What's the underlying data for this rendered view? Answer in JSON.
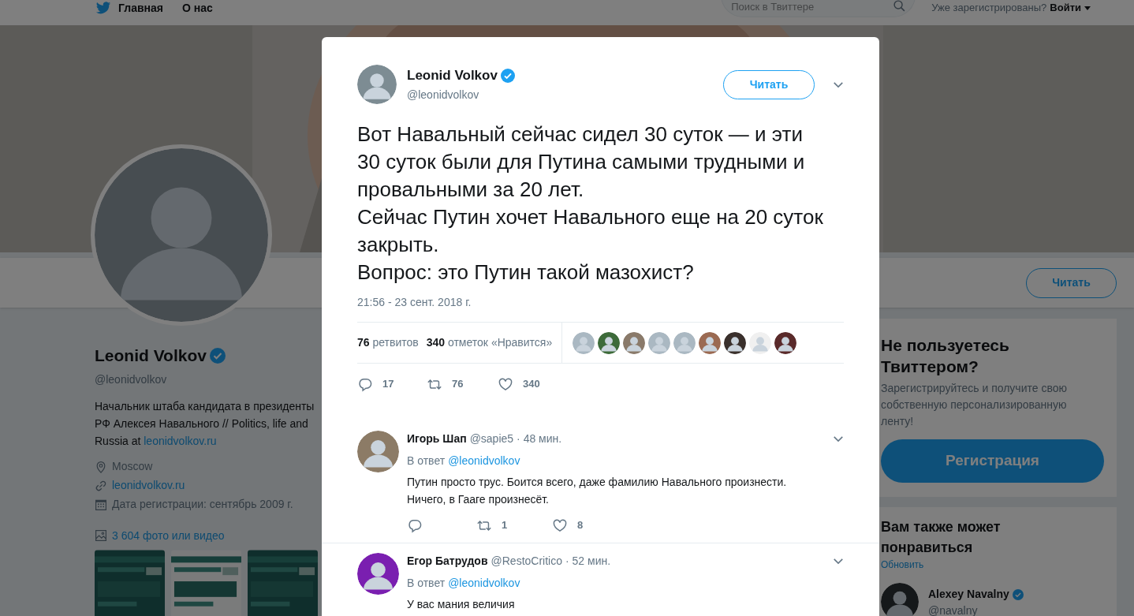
{
  "nav": {
    "items": [
      "Главная",
      "О нас"
    ],
    "search": {
      "placeholder": "Поиск в Твиттере"
    },
    "login_prompt": "Уже зарегистрированы?",
    "login": "Войти"
  },
  "profile": {
    "follow_button": "Читать",
    "name": "Leonid Volkov",
    "verified": true,
    "handle": "@leonidvolkov",
    "bio": "Начальник штаба кандидата в президенты РФ Алексея Навального // Politics, life and Russia at",
    "bio_link": "leonidvolkov.ru",
    "location": "Moscow",
    "website": "leonidvolkov.ru",
    "joined": "Дата регистрации: сентябрь 2009 г.",
    "media_link": "3 604 фото или видео"
  },
  "signup": {
    "title": "Не пользуетесь Твиттером?",
    "text": "Зарегистрируйтесь и получите свою собственную персонализированную ленту!",
    "button": "Регистрация"
  },
  "suggestions": {
    "title": "Вам также может понравиться",
    "refresh": "Обновить",
    "accounts": [
      {
        "name": "Alexey Navalny",
        "verified": true,
        "handle": "@navalny"
      }
    ]
  },
  "tweet": {
    "name": "Leonid Volkov",
    "verified": true,
    "handle": "@leonidvolkov",
    "follow_button": "Читать",
    "text": "Вот Навальный сейчас сидел 30 суток — и эти 30 суток были для Путина самыми трудными и провальными за 20 лет.\nСейчас Путин хочет Навального еще на 20 суток закрыть.\nВопрос: это Путин такой мазохист?",
    "timestamp": "21:56 - 23 сент. 2018 г.",
    "retweets_count": "76",
    "retweets_label": "ретвитов",
    "likes_count": "340",
    "likes_label": "отметок «Нравится»",
    "replies": "17",
    "retweets": "76",
    "likes": "340"
  },
  "replies": [
    {
      "name": "Игорь Шап",
      "handle": "@sapie5",
      "time": "· 48 мин.",
      "reply_to_label": "В ответ",
      "reply_to": "@leonidvolkov",
      "text": "Путин просто трус. Боится всего, даже фамилию Навального произнести.\nНичего, в Гааге произнесёт.",
      "retweets": "1",
      "likes": "8"
    },
    {
      "name": "Егор Батрудов",
      "handle": "@RestoCritico",
      "time": "· 52 мин.",
      "reply_to_label": "В ответ",
      "reply_to": "@leonidvolkov",
      "text": "У вас мания величия"
    }
  ]
}
